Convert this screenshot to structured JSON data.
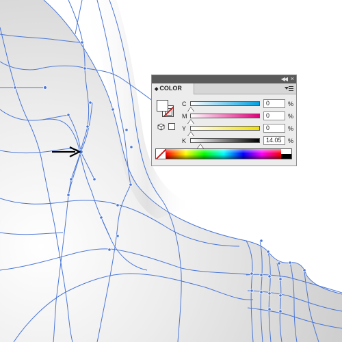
{
  "canvas": {
    "mesh_color": "#4a76d6",
    "surface_color": "#d9d9d9",
    "arrow_color": "#000000",
    "annotation": "arrow-pointing-at-selected-anchor-point"
  },
  "color_panel": {
    "tab_label": "COLOR",
    "collapse_icon": "double-chevron-left-icon",
    "close_icon": "close-icon",
    "menu_icon": "panel-menu-icon",
    "fill": "#ffffff",
    "stroke": "none",
    "channels": [
      {
        "label": "C",
        "value": "0",
        "unit": "%",
        "gradient_end": "#00a0e0"
      },
      {
        "label": "M",
        "value": "0",
        "unit": "%",
        "gradient_end": "#e0007a"
      },
      {
        "label": "Y",
        "value": "0",
        "unit": "%",
        "gradient_end": "#f0e000"
      },
      {
        "label": "K",
        "value": "14.05",
        "unit": "%",
        "gradient_end": "#000000"
      }
    ]
  }
}
